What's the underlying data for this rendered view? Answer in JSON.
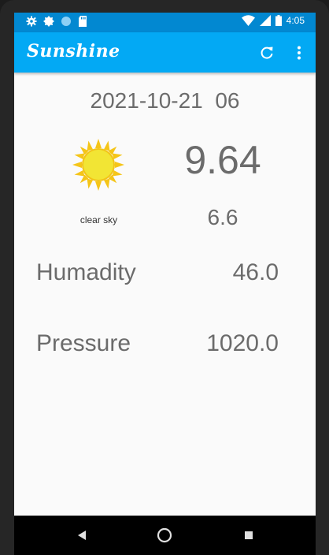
{
  "status_bar": {
    "time": "4:05",
    "icons_left": [
      "settings-gear-icon",
      "brightness-icon",
      "circle-icon",
      "sd-card-icon"
    ],
    "icons_right": [
      "wifi-icon",
      "cellular-signal-icon",
      "battery-icon"
    ]
  },
  "app_bar": {
    "title": "Sunshine",
    "actions": [
      "refresh-icon",
      "overflow-menu-icon"
    ]
  },
  "forecast": {
    "date": "2021-10-21  06",
    "icon": "sun-icon",
    "high": "9.64",
    "low": "6.6",
    "description": "clear sky"
  },
  "details": {
    "humidity_label": "Humadity",
    "humidity_value": "46.0",
    "pressure_label": "Pressure",
    "pressure_value": "1020.0"
  },
  "nav_bar": {
    "buttons": [
      "back-icon",
      "home-icon",
      "recents-icon"
    ]
  },
  "colors": {
    "status_bar": "#0288d1",
    "app_bar": "#03a9f4",
    "text": "#6b6b6b",
    "sun_body": "#f2e534",
    "sun_rays": "#f5c518"
  }
}
